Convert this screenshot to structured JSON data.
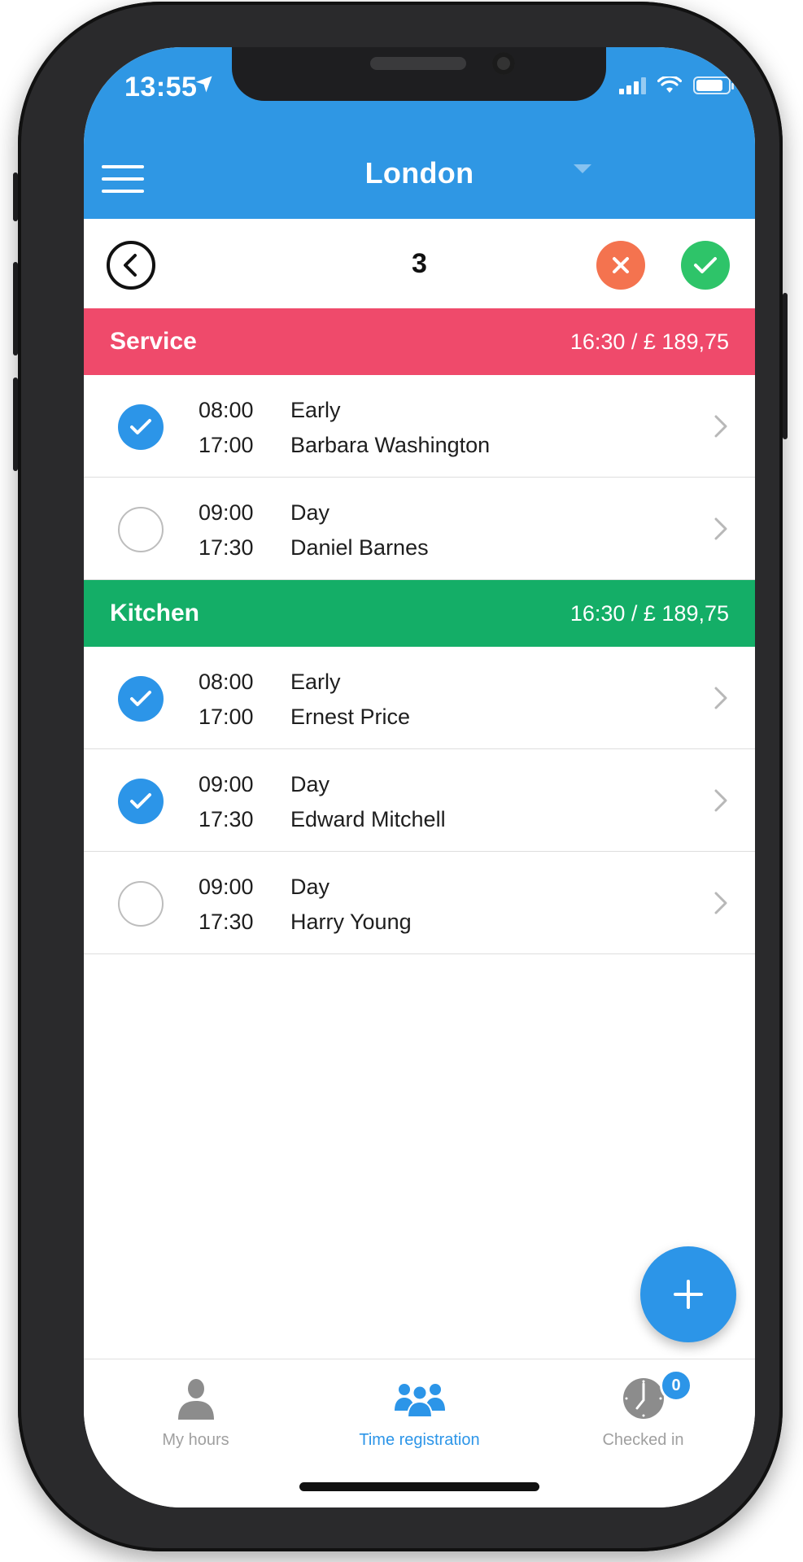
{
  "status_bar": {
    "time": "13:55",
    "location_glyph": "➤"
  },
  "header": {
    "title": "London"
  },
  "date_bar": {
    "day": "3"
  },
  "sections": [
    {
      "name": "Service",
      "total": "16:30 / £ 189,75",
      "color": "#ef4a6b",
      "rows": [
        {
          "checked": true,
          "start": "08:00",
          "end": "17:00",
          "shift": "Early",
          "person": "Barbara Washington"
        },
        {
          "checked": false,
          "start": "09:00",
          "end": "17:30",
          "shift": "Day",
          "person": "Daniel Barnes"
        }
      ]
    },
    {
      "name": "Kitchen",
      "total": "16:30 / £ 189,75",
      "color": "#14ae67",
      "rows": [
        {
          "checked": true,
          "start": "08:00",
          "end": "17:00",
          "shift": "Early",
          "person": "Ernest Price"
        },
        {
          "checked": true,
          "start": "09:00",
          "end": "17:30",
          "shift": "Day",
          "person": "Edward Mitchell"
        },
        {
          "checked": false,
          "start": "09:00",
          "end": "17:30",
          "shift": "Day",
          "person": "Harry Young"
        }
      ]
    }
  ],
  "tabs": [
    {
      "label": "My hours",
      "icon": "person-icon",
      "active": false
    },
    {
      "label": "Time registration",
      "icon": "group-icon",
      "active": true
    },
    {
      "label": "Checked in",
      "icon": "clock-icon",
      "active": false,
      "badge": "0"
    }
  ],
  "colors": {
    "primary": "#2f97e4",
    "accept": "#2ec469",
    "reject": "#f4734f"
  }
}
